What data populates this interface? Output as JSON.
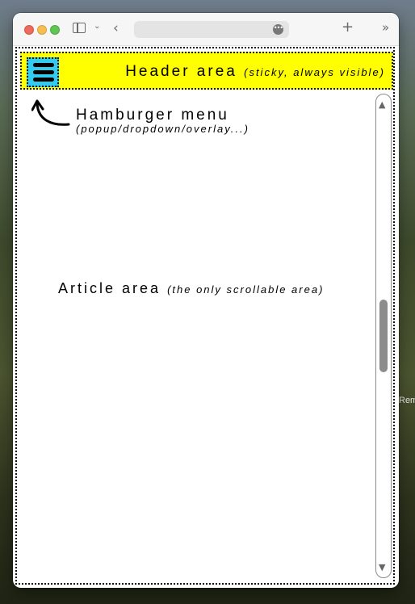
{
  "background": {
    "peek_text": "Rem"
  },
  "browser": {
    "toolbar_icons": [
      "sidebar-icon",
      "chevron-down-icon",
      "back-arrow-icon",
      "more-icon",
      "plus-icon",
      "double-chevron-icon"
    ]
  },
  "header": {
    "label": "Header area",
    "note": "(sticky, always visible)",
    "background": "#ffff00",
    "hamburger_color": "#31ccf0"
  },
  "hamburger_menu": {
    "label": "Hamburger menu",
    "sub": "(popup/dropdown/overlay...)"
  },
  "article": {
    "label": "Article area",
    "note": "(the only scrollable area)"
  },
  "scrollbar": {
    "up_glyph": "▲",
    "down_glyph": "▼"
  }
}
